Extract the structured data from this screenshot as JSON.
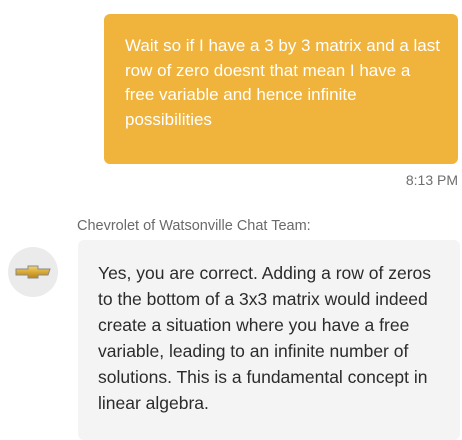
{
  "messages": {
    "user": {
      "text": "Wait so if I have a 3 by 3 matrix and a last row of zero doesnt that mean I have a free variable and hence infinite possibilities",
      "time": "8:13 PM",
      "bubble_color": "#f0b43c"
    },
    "agent": {
      "name": "Chevrolet of Watsonville Chat Team:",
      "avatar_icon": "chevrolet-bowtie-logo",
      "text": "Yes, you are correct. Adding a row of zeros to the bottom of a 3x3 matrix would indeed create a situation where you have a free variable, leading to an infinite number of solutions. This is a fundamental concept in linear algebra."
    }
  }
}
